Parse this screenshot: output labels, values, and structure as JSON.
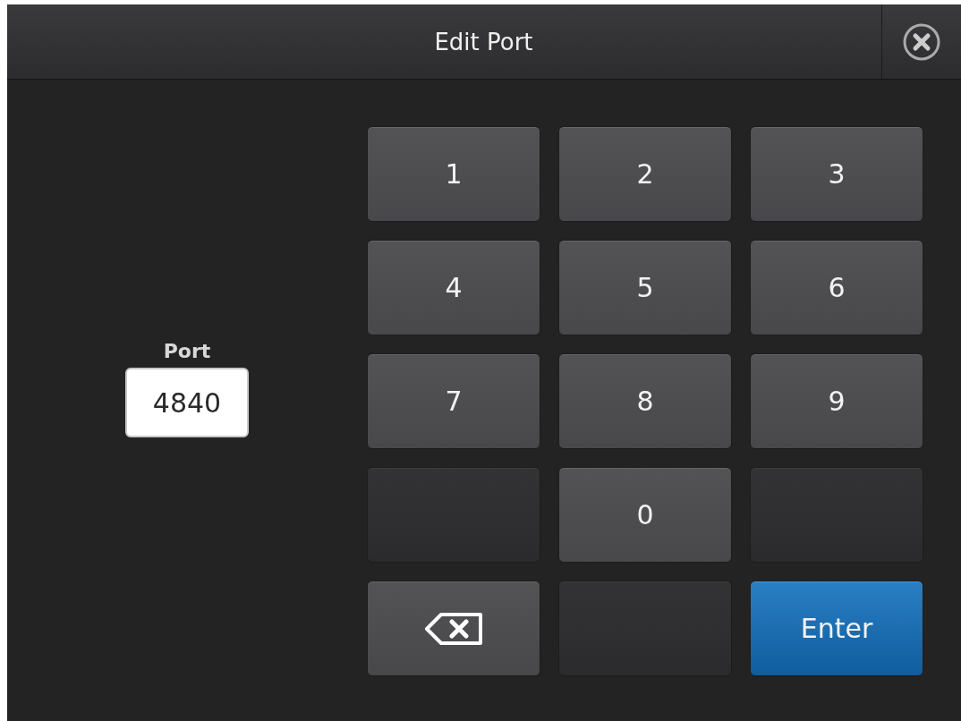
{
  "window": {
    "title": "Edit Port"
  },
  "field": {
    "label": "Port",
    "value": "4840"
  },
  "keys": [
    {
      "kind": "digit",
      "label": "1"
    },
    {
      "kind": "digit",
      "label": "2"
    },
    {
      "kind": "digit",
      "label": "3"
    },
    {
      "kind": "digit",
      "label": "4"
    },
    {
      "kind": "digit",
      "label": "5"
    },
    {
      "kind": "digit",
      "label": "6"
    },
    {
      "kind": "digit",
      "label": "7"
    },
    {
      "kind": "digit",
      "label": "8"
    },
    {
      "kind": "digit",
      "label": "9"
    },
    {
      "kind": "blank"
    },
    {
      "kind": "digit",
      "label": "0"
    },
    {
      "kind": "blank"
    },
    {
      "kind": "backspace"
    },
    {
      "kind": "blank"
    },
    {
      "kind": "enter",
      "label": "Enter"
    }
  ]
}
